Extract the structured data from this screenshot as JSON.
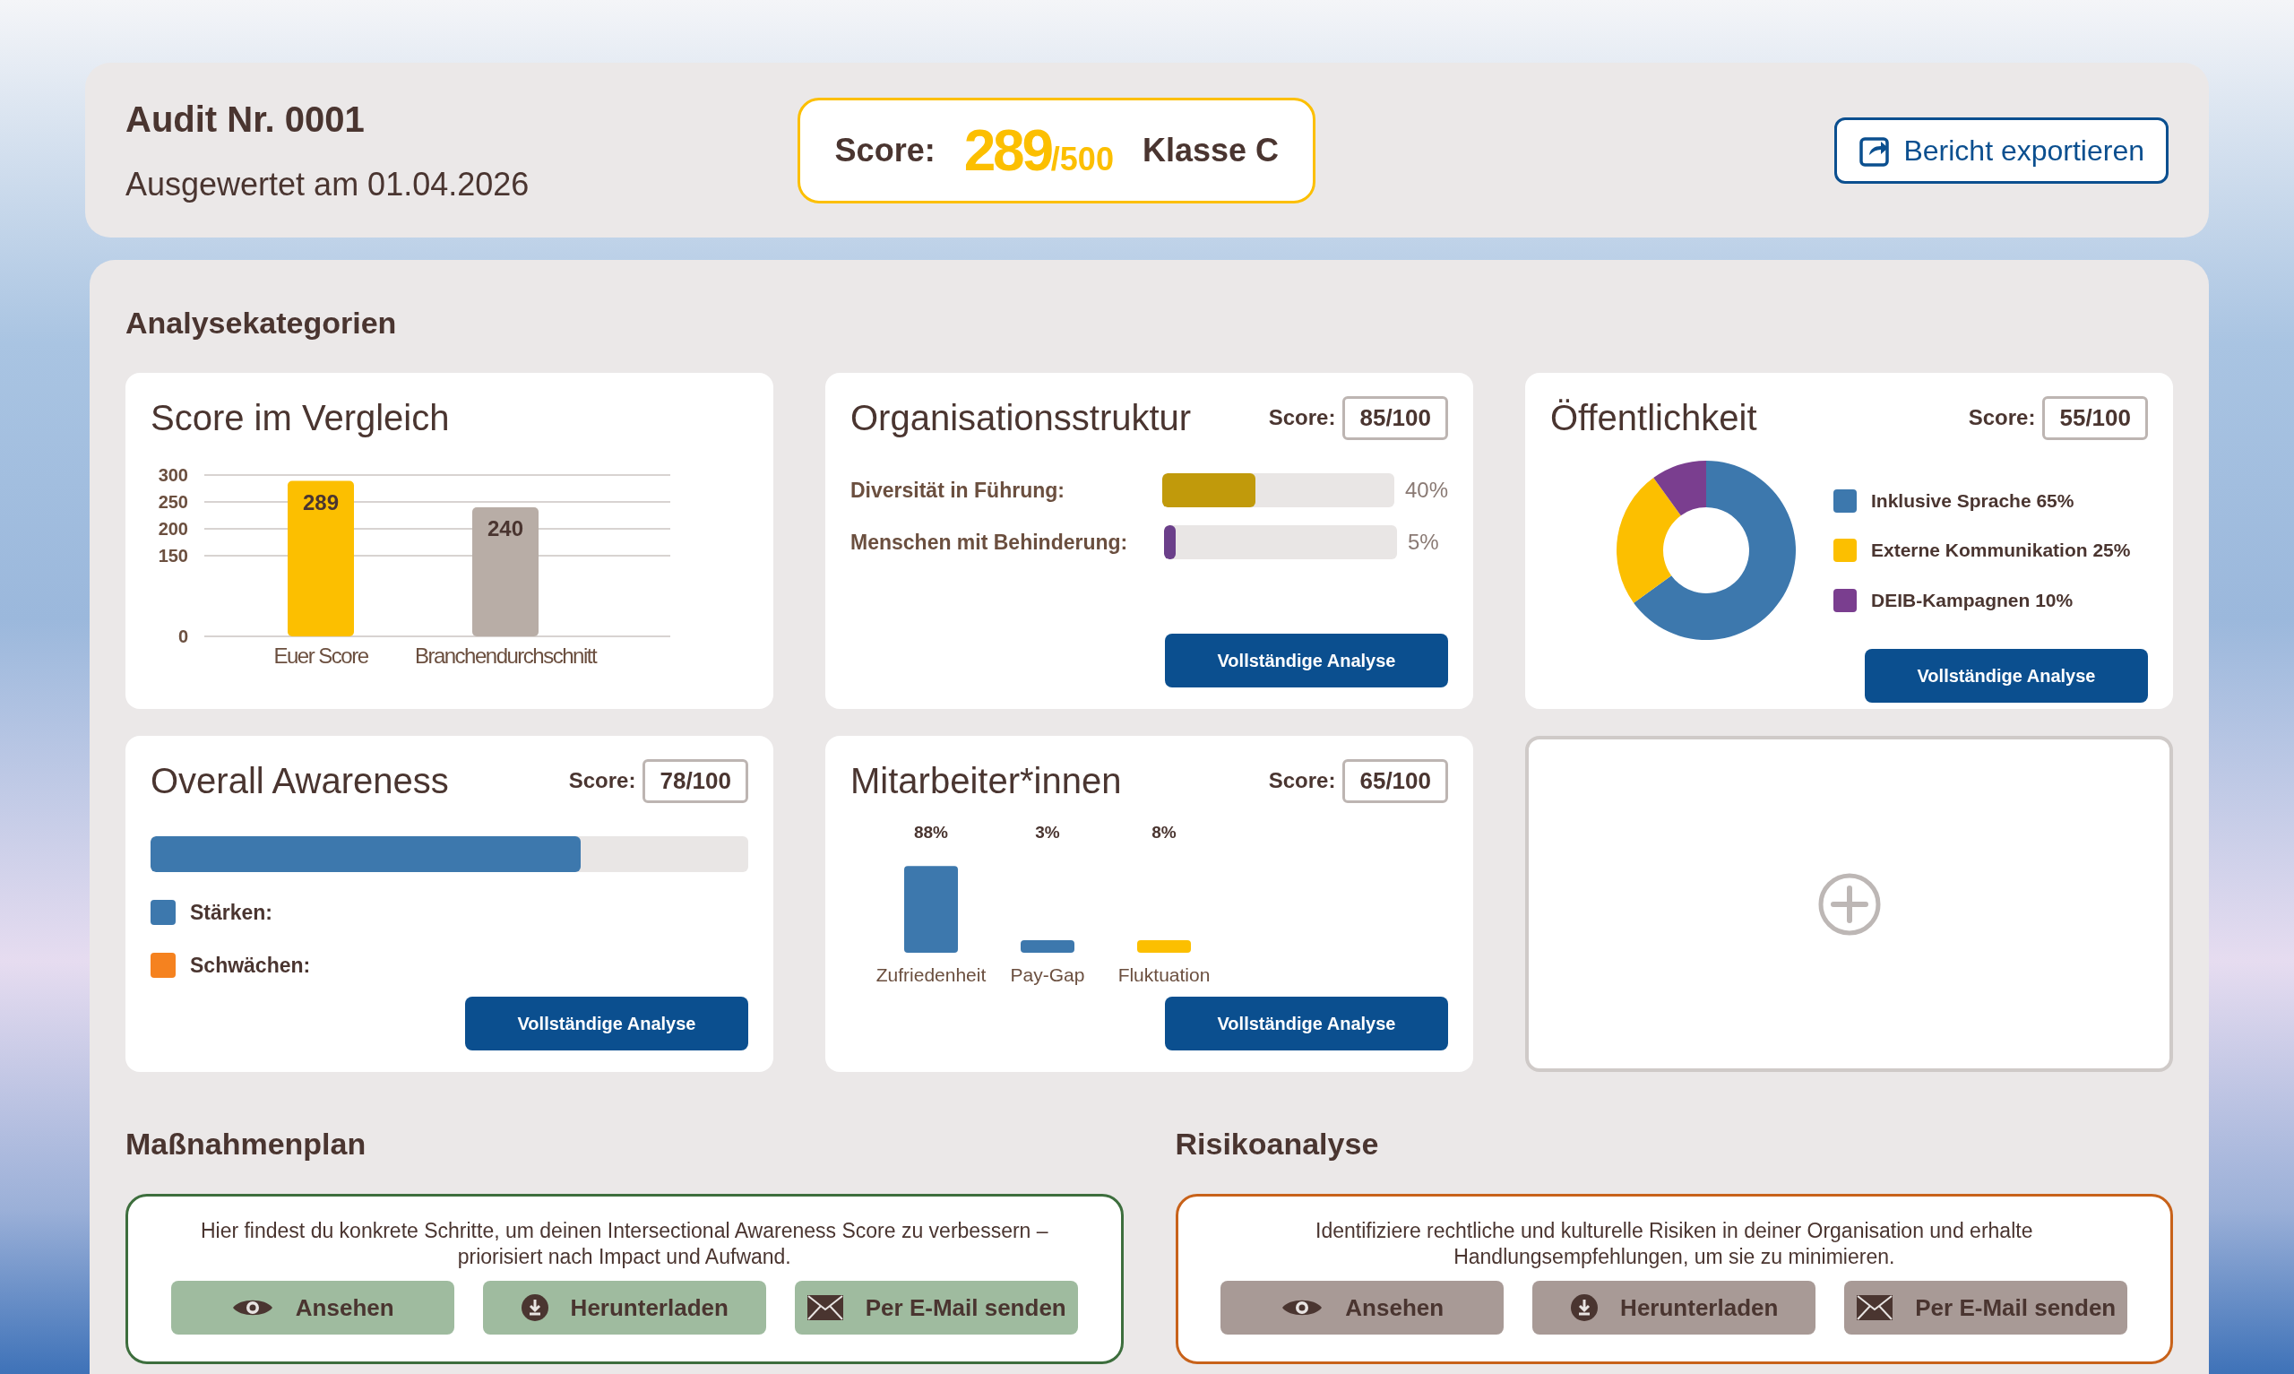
{
  "header": {
    "title": "Audit Nr. 0001",
    "subtitle": "Ausgewertet am 01.04.2026",
    "score_label": "Score:",
    "score": "289",
    "score_max": "/500",
    "class": "Klasse C",
    "export_button": "Bericht exportieren"
  },
  "analysis": {
    "heading": "Analysekategorien",
    "cards": [
      {
        "kind": "bar_chart",
        "title": "Score im Vergleich",
        "chart_data": {
          "type": "bar",
          "categories": [
            "Euer Score",
            "Branchendurchschnitt"
          ],
          "values": [
            289,
            240
          ],
          "ylim": [
            0,
            300
          ],
          "yticks": [
            0,
            150,
            200,
            250,
            300
          ],
          "grid": true,
          "data_labels": true
        }
      },
      {
        "kind": "meters",
        "title": "Organisationsstruktur",
        "score_label": "Score:",
        "score": "85/100",
        "meters": [
          {
            "label": "Diversität in Führung:",
            "level": 0.4,
            "reading": "40%",
            "color": "#c19a0b"
          },
          {
            "label": "Menschen mit Behinderung:",
            "level": 0.05,
            "reading": "5%",
            "color": "#6b3f8a"
          }
        ],
        "button": "Vollständige Analyse"
      },
      {
        "kind": "donut",
        "title": "Öffentlichkeit",
        "score_label": "Score:",
        "score": "55/100",
        "legend": [
          {
            "label": "Inklusive Sprache 65%",
            "color": "#3d78ad"
          },
          {
            "label": "Externe Kommunikation 25%",
            "color": "#fcbf00"
          },
          {
            "label": "DEIB-Kampagnen 10%",
            "color": "#7a3e8f"
          }
        ],
        "button": "Vollständige Analyse"
      },
      {
        "kind": "progress",
        "title": "Overall Awareness",
        "score_label": "Score:",
        "score": "78/100",
        "level": 0.72,
        "legend": [
          {
            "label": "Stärken:",
            "color": "#3d78ad"
          },
          {
            "label": "Schwächen:",
            "color": "#f5821f"
          }
        ],
        "button": "Vollständige Analyse"
      },
      {
        "kind": "small_bars",
        "title": "Mitarbeiter*innen",
        "score_label": "Score:",
        "score": "65/100",
        "bars": [
          {
            "label": "Zufriedenheit",
            "value": "88%",
            "color": "#3d78ad"
          },
          {
            "label": "Pay-Gap",
            "value": "3%",
            "color": "#3d78ad"
          },
          {
            "label": "Fluktuation",
            "value": "8%",
            "color": "#fcbf00"
          }
        ],
        "button": "Vollständige Analyse"
      },
      {
        "kind": "add"
      }
    ]
  },
  "sections": [
    {
      "heading": "Maßnahmenplan",
      "text": "Hier findest du konkrete Schritte, um deinen Intersectional Awareness Score zu verbessern – priorisiert nach Impact und Aufwand.",
      "kind": "plan",
      "color": "#3d6e3d",
      "buttons": [
        {
          "kind": "view",
          "label": "Ansehen"
        },
        {
          "kind": "download",
          "label": "Herunterladen"
        },
        {
          "kind": "email",
          "label": "Per E-Mail senden"
        }
      ]
    },
    {
      "heading": "Risikoanalyse",
      "text": "Identifiziere rechtliche und kulturelle Risiken in deiner Organisation und erhalte Handlungsempfehlungen, um sie zu minimieren.",
      "kind": "risk",
      "color": "#c8621a",
      "buttons": [
        {
          "kind": "view",
          "label": "Ansehen"
        },
        {
          "kind": "download",
          "label": "Herunterladen"
        },
        {
          "kind": "email",
          "label": "Per E-Mail senden"
        }
      ]
    }
  ]
}
